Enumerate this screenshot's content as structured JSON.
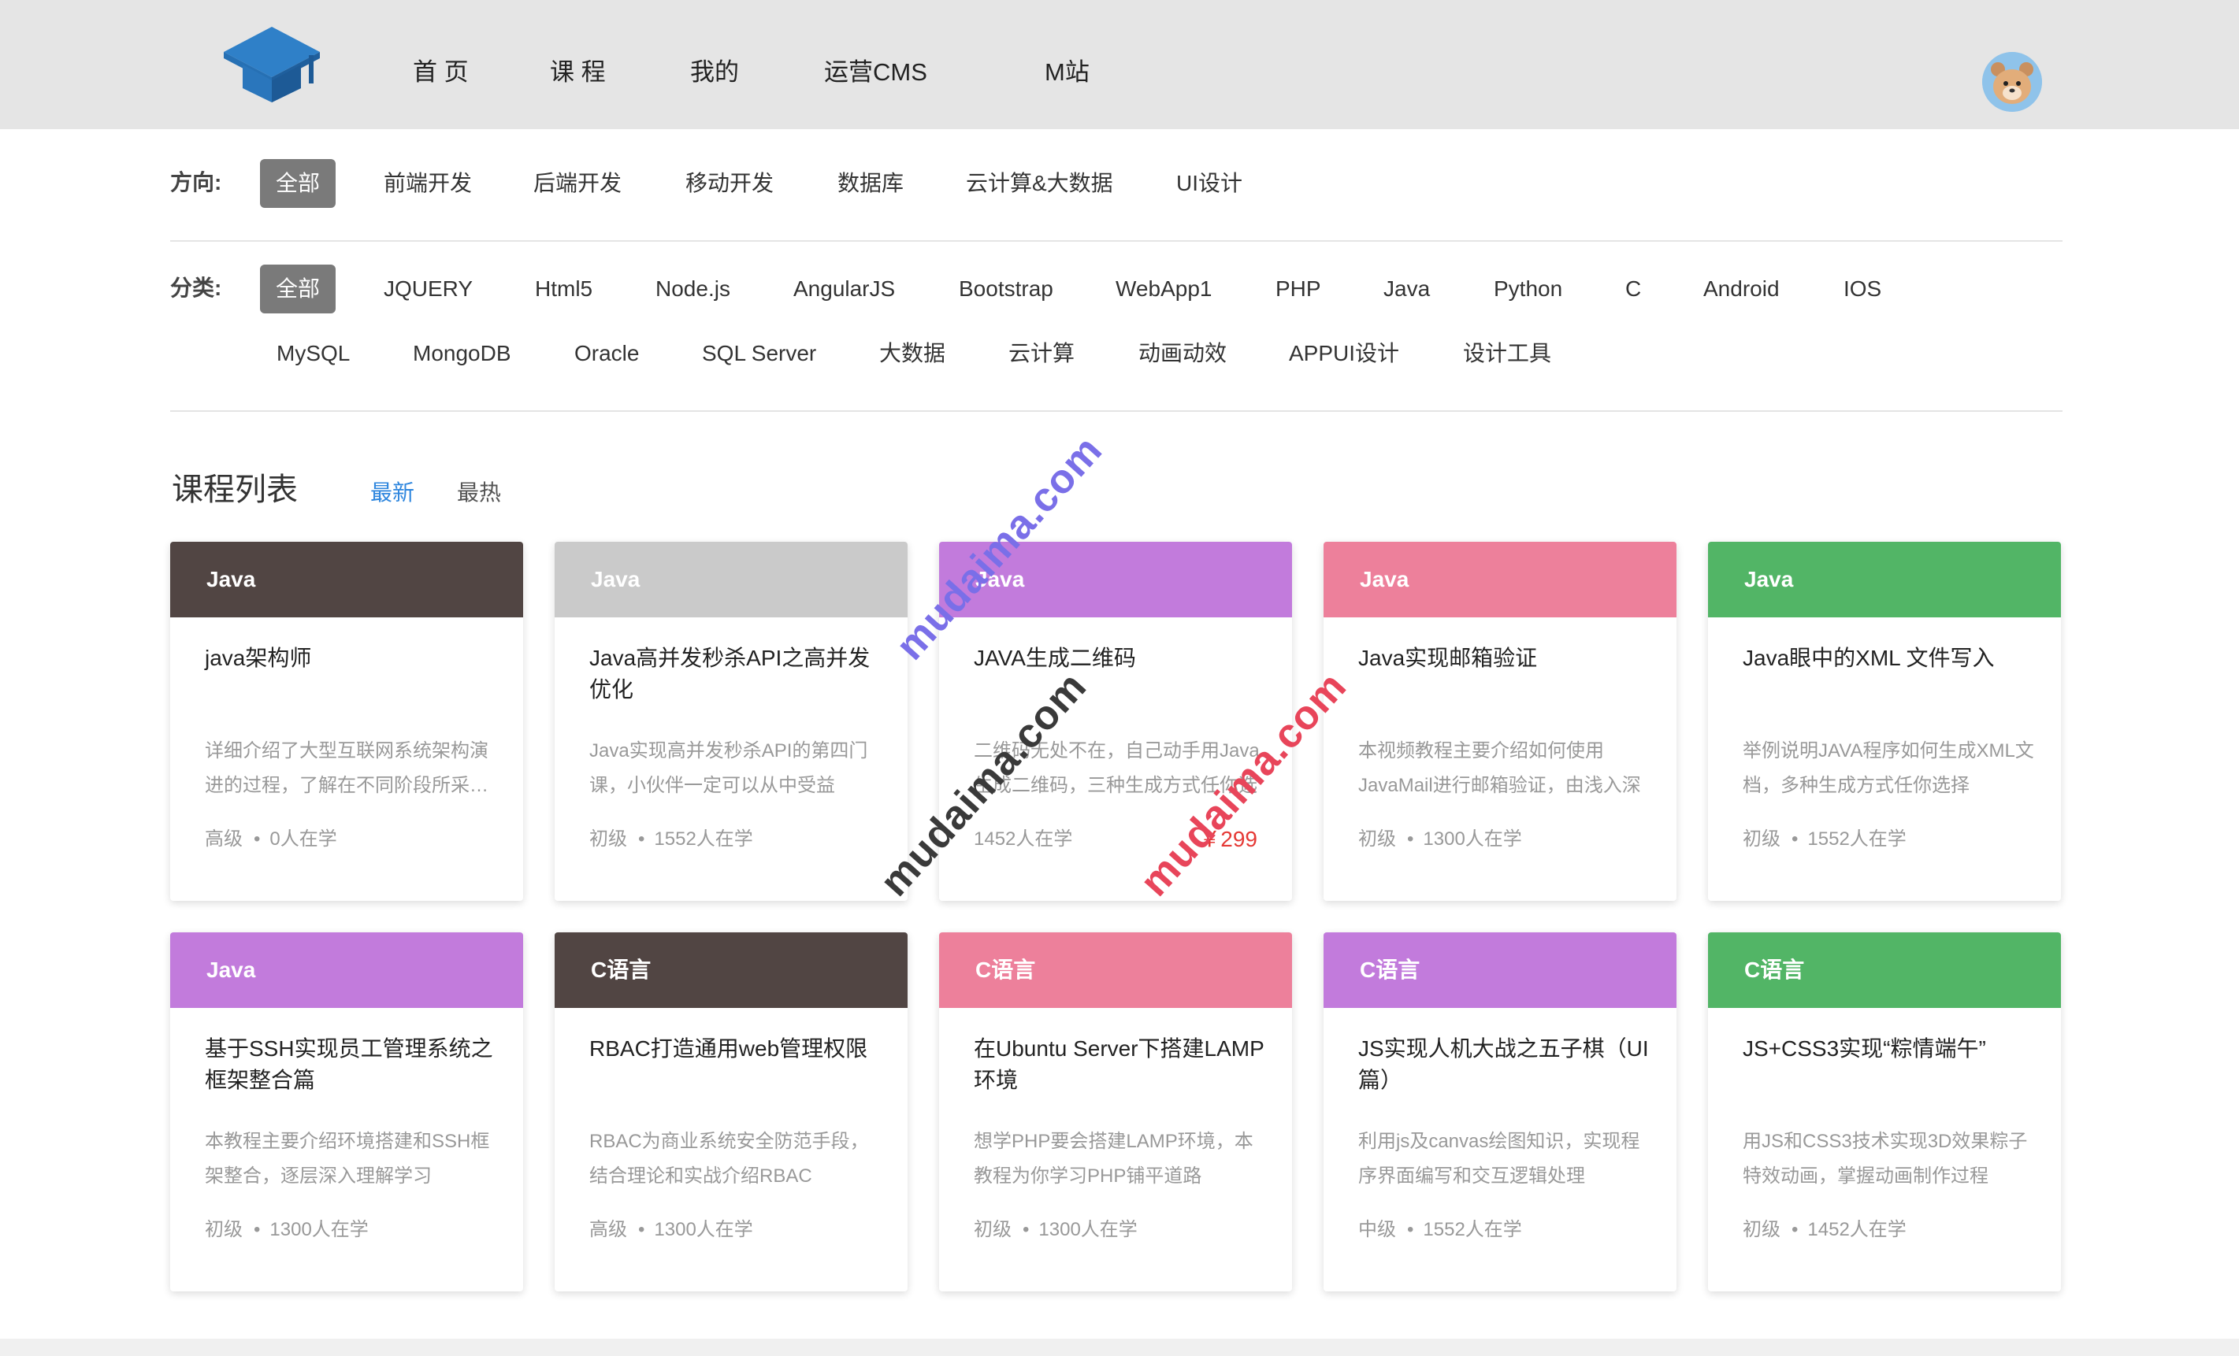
{
  "nav": {
    "items": [
      "首 页",
      "课 程",
      "我的",
      "运营CMS",
      "M站"
    ]
  },
  "filters": {
    "direction": {
      "label": "方向:",
      "options": [
        "全部",
        "前端开发",
        "后端开发",
        "移动开发",
        "数据库",
        "云计算&大数据",
        "UI设计"
      ]
    },
    "category": {
      "label": "分类:",
      "options": [
        "全部",
        "JQUERY",
        "Html5",
        "Node.js",
        "AngularJS",
        "Bootstrap",
        "WebApp1",
        "PHP",
        "Java",
        "Python",
        "C",
        "Android",
        "IOS",
        "MySQL",
        "MongoDB",
        "Oracle",
        "SQL Server",
        "大数据",
        "云计算",
        "动画动效",
        "APPUI设计",
        "设计工具"
      ]
    }
  },
  "course_list": {
    "title": "课程列表",
    "sort_tabs": [
      "最新",
      "最热"
    ],
    "cards": [
      {
        "tag": "Java",
        "color": "#514543",
        "title": "java架构师",
        "desc": "详细介绍了大型互联网系统架构演进的过程，了解在不同阶段所采取的架构策略",
        "level": "高级",
        "students": "0人在学"
      },
      {
        "tag": "Java",
        "color": "#cacaca",
        "title": "Java高并发秒杀API之高并发优化",
        "desc": "Java实现高并发秒杀API的第四门课，小伙伴一定可以从中受益",
        "level": "初级",
        "students": "1552人在学"
      },
      {
        "tag": "Java",
        "color": "#c27bdc",
        "title": "JAVA生成二维码",
        "desc": "二维码无处不在，自己动手用Java生成二维码，三种生成方式任你选",
        "level": "",
        "students": "1452人在学",
        "price": "￥299"
      },
      {
        "tag": "Java",
        "color": "#ed809b",
        "title": "Java实现邮箱验证",
        "desc": "本视频教程主要介绍如何使用JavaMail进行邮箱验证，由浅入深",
        "level": "初级",
        "students": "1300人在学"
      },
      {
        "tag": "Java",
        "color": "#52b566",
        "title": "Java眼中的XML 文件写入",
        "desc": "举例说明JAVA程序如何生成XML文档，多种生成方式任你选择",
        "level": "初级",
        "students": "1552人在学"
      },
      {
        "tag": "Java",
        "color": "#c27bdc",
        "title": "基于SSH实现员工管理系统之框架整合篇",
        "desc": "本教程主要介绍环境搭建和SSH框架整合，逐层深入理解学习",
        "level": "初级",
        "students": "1300人在学"
      },
      {
        "tag": "C语言",
        "color": "#514543",
        "title": "RBAC打造通用web管理权限",
        "desc": "RBAC为商业系统安全防范手段，结合理论和实战介绍RBAC",
        "level": "高级",
        "students": "1300人在学"
      },
      {
        "tag": "C语言",
        "color": "#ed809b",
        "title": "在Ubuntu Server下搭建LAMP环境",
        "desc": "想学PHP要会搭建LAMP环境，本教程为你学习PHP铺平道路",
        "level": "初级",
        "students": "1300人在学"
      },
      {
        "tag": "C语言",
        "color": "#c27bdc",
        "title": "JS实现人机大战之五子棋（UI篇）",
        "desc": "利用js及canvas绘图知识，实现程序界面编写和交互逻辑处理",
        "level": "中级",
        "students": "1552人在学"
      },
      {
        "tag": "C语言",
        "color": "#52b566",
        "title": "JS+CSS3实现“粽情端午”",
        "desc": "用JS和CSS3技术实现3D效果粽子特效动画，掌握动画制作过程",
        "level": "初级",
        "students": "1452人在学"
      }
    ]
  },
  "watermarks": [
    "mudaima.com",
    "mudaima.com",
    "mudaima.com"
  ]
}
